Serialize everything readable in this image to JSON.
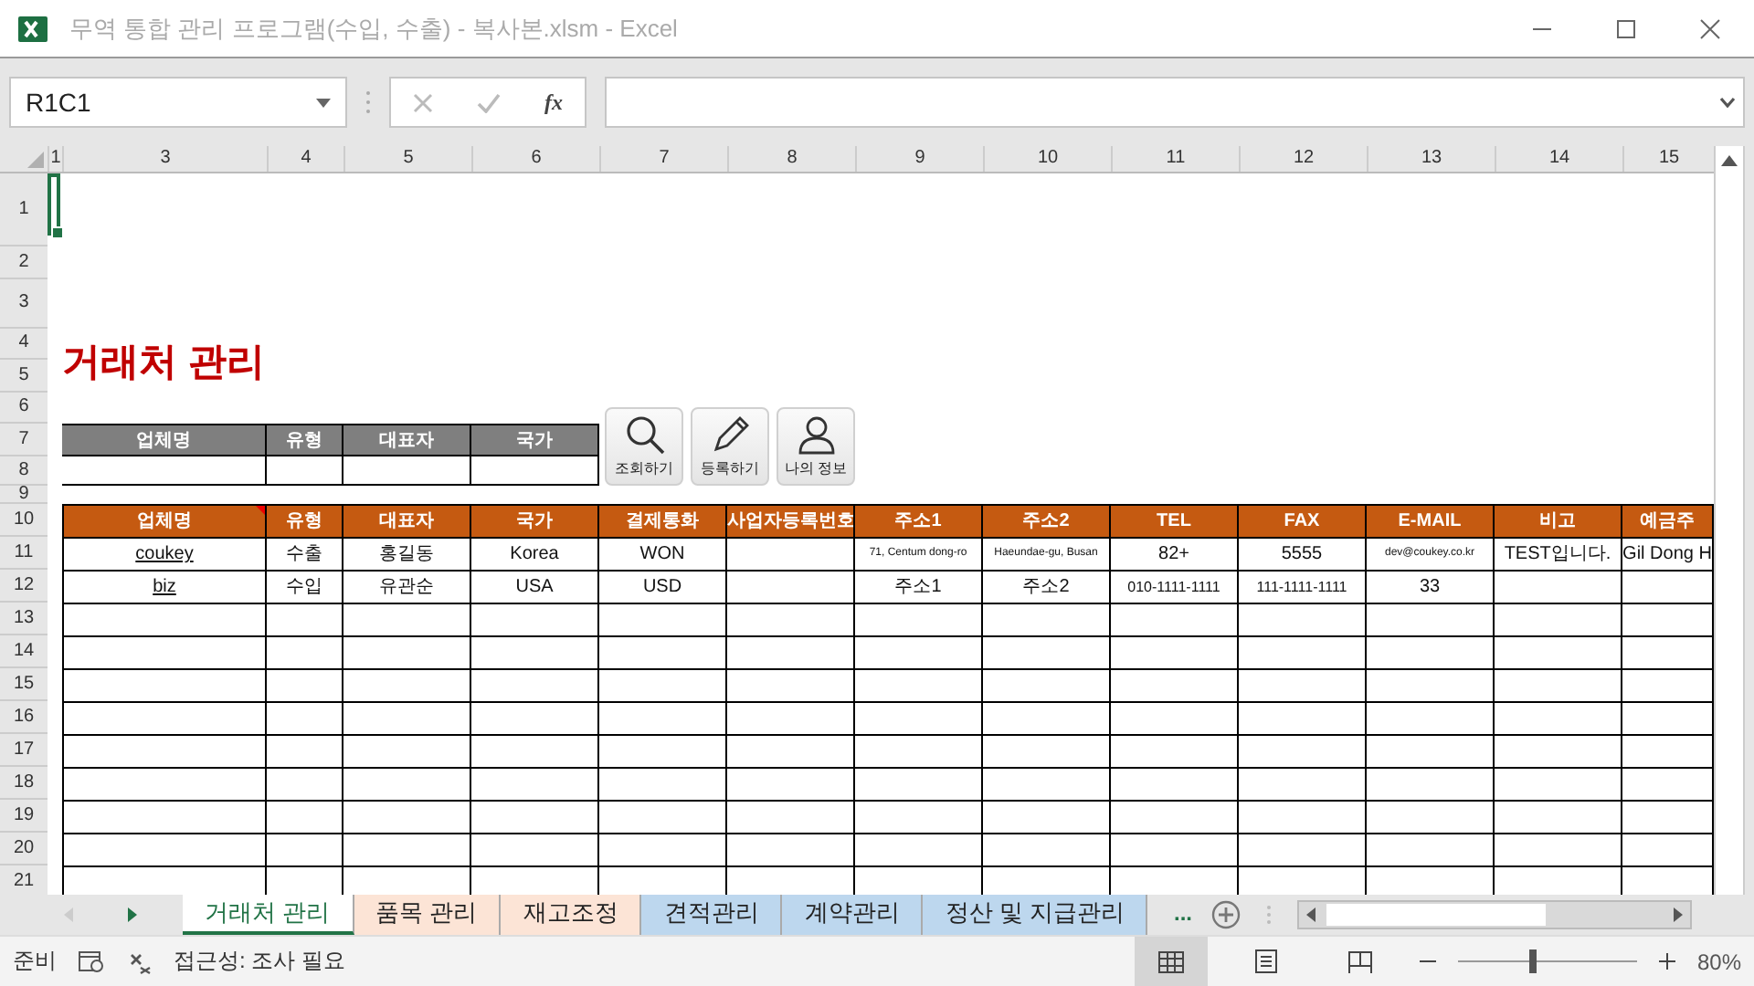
{
  "window": {
    "title": "무역 통합 관리 프로그램(수입, 수출) - 복사본.xlsm - Excel"
  },
  "formula_bar": {
    "name_box": "R1C1",
    "fx": "fx"
  },
  "column_headers": [
    "1",
    "3",
    "4",
    "5",
    "6",
    "7",
    "8",
    "9",
    "10",
    "11",
    "12",
    "13",
    "14",
    "15"
  ],
  "row_headers": [
    "1",
    "2",
    "3",
    "4",
    "5",
    "6",
    "7",
    "8",
    "9",
    "10",
    "11",
    "12",
    "13",
    "14",
    "15",
    "16",
    "17",
    "18",
    "19",
    "20",
    "21"
  ],
  "sheet": {
    "title": "거래처 관리",
    "search_table": {
      "columns": [
        "업체명",
        "유형",
        "대표자",
        "국가"
      ]
    },
    "buttons": [
      {
        "label": "조회하기",
        "kind": "search"
      },
      {
        "label": "등록하기",
        "kind": "edit"
      },
      {
        "label": "나의 정보",
        "kind": "profile"
      }
    ],
    "data_table": {
      "columns": [
        "업체명",
        "유형",
        "대표자",
        "국가",
        "결제통화",
        "사업자등록번호",
        "주소1",
        "주소2",
        "TEL",
        "FAX",
        "E-MAIL",
        "비고",
        "예금주"
      ],
      "rows": [
        {
          "cells": [
            "coukey",
            "수출",
            "홍길동",
            "Korea",
            "WON",
            null,
            "71, Centum dong-ro",
            "Haeundae-gu, Busan",
            "82+",
            "5555",
            "dev@coukey.co.kr",
            "TEST입니다.",
            "Gil Dong H"
          ]
        },
        {
          "cells": [
            "biz",
            "수입",
            "유관순",
            "USA",
            "USD",
            null,
            "주소1",
            "주소2",
            "010-1111-1111",
            "111-1111-1111",
            "33",
            null,
            null
          ]
        }
      ]
    }
  },
  "sheet_tabs": [
    {
      "label": "거래처 관리",
      "selected": true,
      "color": "#ffffff"
    },
    {
      "label": "품목 관리",
      "selected": false,
      "color": "#fce4d6"
    },
    {
      "label": "재고조정",
      "selected": false,
      "color": "#fce4d6"
    },
    {
      "label": "견적관리",
      "selected": false,
      "color": "#bdd7ee"
    },
    {
      "label": "계약관리",
      "selected": false,
      "color": "#bdd7ee"
    },
    {
      "label": "정산 및 지급관리",
      "selected": false,
      "color": "#bdd7ee"
    }
  ],
  "more_tabs": "...",
  "status_bar": {
    "ready": "준비",
    "accessibility": "접근성: 조사 필요",
    "view_modes": [
      {
        "kind": "normal",
        "selected": true
      },
      {
        "kind": "page_layout",
        "selected": false
      },
      {
        "kind": "page_break",
        "selected": false
      }
    ],
    "zoom": {
      "level": 0.4,
      "value": "80%"
    }
  }
}
